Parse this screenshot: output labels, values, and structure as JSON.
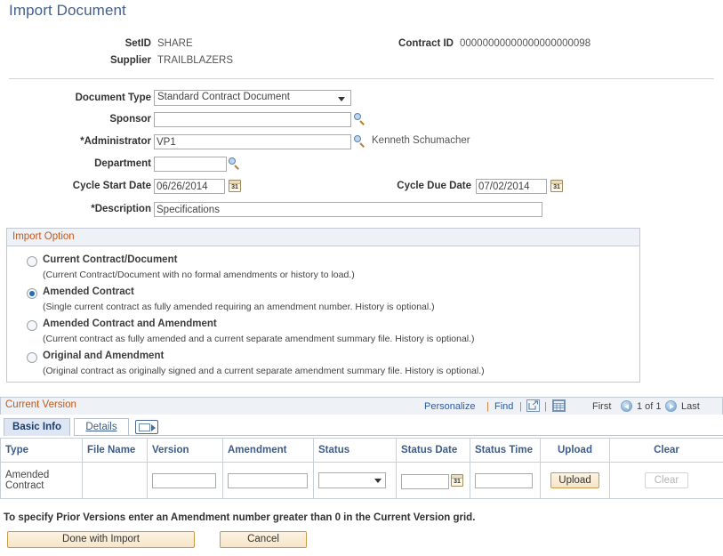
{
  "page": {
    "title": "Import Document"
  },
  "header": {
    "setid_label": "SetID",
    "setid_value": "SHARE",
    "supplier_label": "Supplier",
    "supplier_value": "TRAILBLAZERS",
    "contract_id_label": "Contract ID",
    "contract_id_value": "00000000000000000000098"
  },
  "form": {
    "document_type_label": "Document Type",
    "document_type_value": "Standard Contract Document",
    "sponsor_label": "Sponsor",
    "sponsor_value": "",
    "administrator_label": "*Administrator",
    "administrator_value": "VP1",
    "administrator_name": "Kenneth Schumacher",
    "department_label": "Department",
    "department_value": "",
    "cycle_start_date_label": "Cycle Start Date",
    "cycle_start_date_value": "06/26/2014",
    "cycle_due_date_label": "Cycle Due Date",
    "cycle_due_date_value": "07/02/2014",
    "description_label": "*Description",
    "description_value": "Specifications",
    "calendar_day": "31"
  },
  "import_option": {
    "title": "Import Option",
    "options": [
      {
        "label": "Current Contract/Document",
        "description": "(Current Contract/Document with no formal amendments or history to load.)",
        "selected": false
      },
      {
        "label": "Amended Contract",
        "description": "(Single current contract as fully amended requiring an amendment number. History is optional.)",
        "selected": true
      },
      {
        "label": "Amended Contract and Amendment",
        "description": "(Current contract as fully amended and a current separate amendment summary file. History is optional.)",
        "selected": false
      },
      {
        "label": "Original and Amendment",
        "description": "(Original contract as originally signed and a current separate amendment summary file. History is optional.)",
        "selected": false
      }
    ]
  },
  "current_version": {
    "title": "Current Version",
    "personalize_label": "Personalize",
    "find_label": "Find",
    "separator": "|",
    "export_icon": "export-to-excel-icon",
    "grid_icon": "view-all-grid-icon",
    "first_label": "First",
    "page_indicator": "1 of 1",
    "last_label": "Last",
    "tabs": [
      {
        "label": "Basic Info",
        "active": true
      },
      {
        "label": "Details",
        "active": false
      }
    ],
    "tab_icon": "show-all-columns-icon",
    "columns": [
      "Type",
      "File Name",
      "Version",
      "Amendment",
      "Status",
      "Status Date",
      "Status Time",
      "Upload",
      "Clear"
    ],
    "rows": [
      {
        "type": "Amended Contract",
        "file_name": "",
        "version": "",
        "amendment": "",
        "status": "",
        "status_date": "",
        "status_time": "",
        "upload_label": "Upload",
        "clear_label": "Clear"
      }
    ]
  },
  "footer": {
    "note": "To specify Prior Versions enter an Amendment number greater than 0 in the Current Version grid.",
    "done_label": "Done with Import",
    "cancel_label": "Cancel"
  },
  "colors": {
    "title_blue": "#44618c",
    "group_orange": "#c05a1e",
    "link_blue": "#2b5ba8",
    "button_tan": "#f6e5c9",
    "button_border": "#c99a4e",
    "header_bg": "#eef1f5",
    "radio_dot": "#2a6bb5"
  }
}
